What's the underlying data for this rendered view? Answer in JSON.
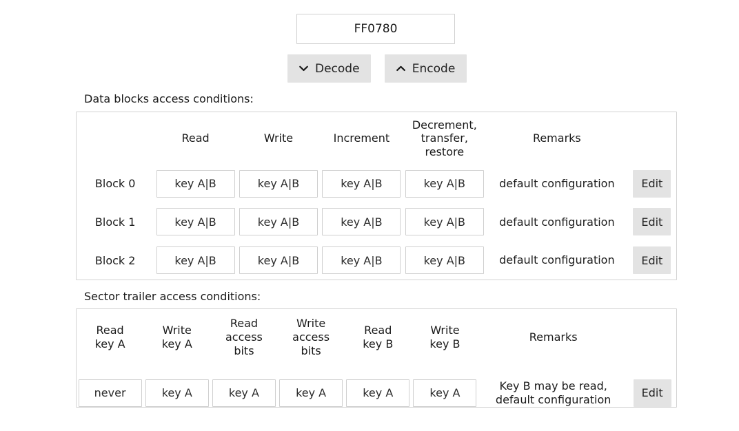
{
  "input": {
    "value": "FF0780",
    "placeholder": "",
    "name": "access-bits-hex-input"
  },
  "actions": {
    "decode": {
      "label": "Decode",
      "icon": "chevron-down-icon"
    },
    "encode": {
      "label": "Encode",
      "icon": "chevron-up-icon"
    }
  },
  "data_blocks": {
    "section_label": "Data blocks access conditions:",
    "headers": [
      "",
      "Read",
      "Write",
      "Increment",
      "Decrement,\ntransfer,\nrestore",
      "Remarks",
      ""
    ],
    "header_decrement_lines": [
      "Decrement,",
      "transfer,",
      "restore"
    ],
    "rows": [
      {
        "block": "Block 0",
        "read": "key A|B",
        "write": "key A|B",
        "increment": "key A|B",
        "decrement": "key A|B",
        "remarks": "default configuration",
        "edit_label": "Edit"
      },
      {
        "block": "Block 1",
        "read": "key A|B",
        "write": "key A|B",
        "increment": "key A|B",
        "decrement": "key A|B",
        "remarks": "default configuration",
        "edit_label": "Edit"
      },
      {
        "block": "Block 2",
        "read": "key A|B",
        "write": "key A|B",
        "increment": "key A|B",
        "decrement": "key A|B",
        "remarks": "default configuration",
        "edit_label": "Edit"
      }
    ]
  },
  "sector_trailer": {
    "section_label": "Sector trailer access conditions:",
    "headers": [
      {
        "line1": "Read",
        "line2": "key A",
        "line3": ""
      },
      {
        "line1": "Write",
        "line2": "key A",
        "line3": ""
      },
      {
        "line1": "Read",
        "line2": "access",
        "line3": "bits"
      },
      {
        "line1": "Write",
        "line2": "access",
        "line3": "bits"
      },
      {
        "line1": "Read",
        "line2": "key B",
        "line3": ""
      },
      {
        "line1": "Write",
        "line2": "key B",
        "line3": ""
      },
      {
        "line1": "Remarks",
        "line2": "",
        "line3": ""
      }
    ],
    "row": {
      "read_key_a": "never",
      "write_key_a": "key A",
      "read_access_bits": "key A",
      "write_access_bits": "key A",
      "read_key_b": "key A",
      "write_key_b": "key A",
      "remarks_line1": "Key B may be read,",
      "remarks_line2": "default configuration",
      "edit_label": "Edit"
    }
  },
  "colors": {
    "button_gray": "#e3e3e3",
    "panel_border": "#d2d2d2",
    "cell_border": "#cfcfcf",
    "text": "#1a1a1a",
    "page_background": "#ffffff"
  }
}
